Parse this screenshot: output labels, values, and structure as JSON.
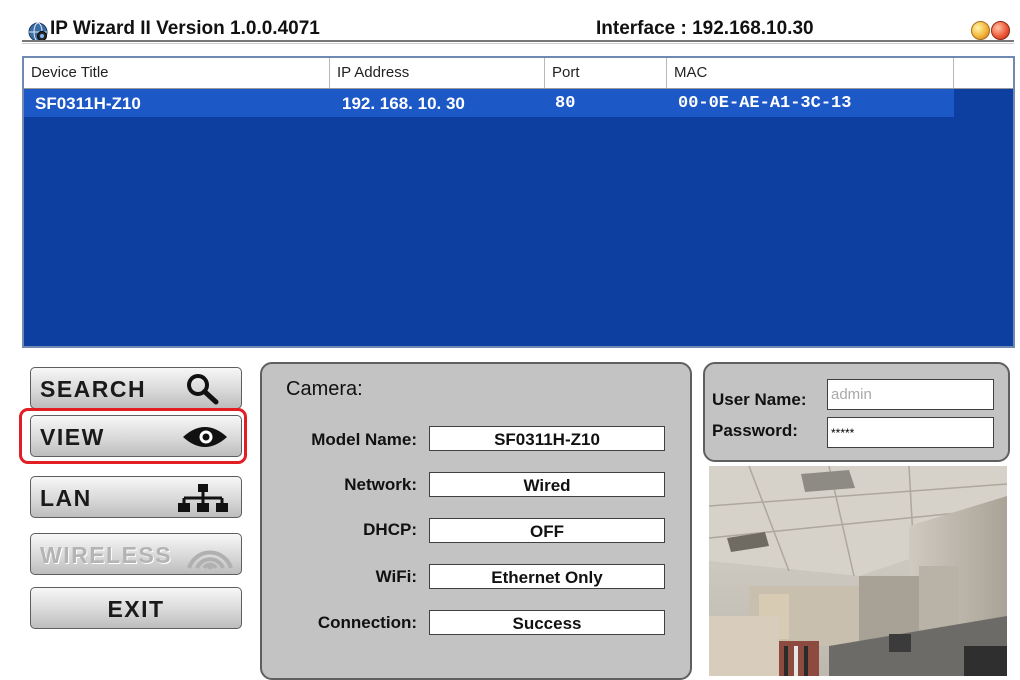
{
  "titlebar": {
    "title": "IP Wizard II  Version 1.0.0.4071",
    "interface": "Interface : 192.168.10.30",
    "logo_icon": "globe-camera-icon",
    "minimize_icon": "minimize-orb-icon",
    "close_icon": "close-orb-icon"
  },
  "device_list": {
    "columns": [
      "Device Title",
      "IP Address",
      "Port",
      "MAC"
    ],
    "rows": [
      {
        "title": "SF0311H-Z10",
        "ip": "192. 168. 10. 30",
        "port": "80",
        "mac": "00-0E-AE-A1-3C-13"
      }
    ],
    "background_color": "#0c3fa0",
    "selected_row_color": "#1d58c7"
  },
  "buttons": {
    "search": {
      "label": "SEARCH",
      "icon": "magnifier-icon"
    },
    "view": {
      "label": "VIEW",
      "icon": "eye-icon",
      "highlighted": true
    },
    "lan": {
      "label": "LAN",
      "icon": "network-icon"
    },
    "wireless": {
      "label": "WIRELESS",
      "icon": "wifi-icon",
      "enabled": false
    },
    "exit": {
      "label": "EXIT"
    }
  },
  "highlight_color": "#e11e24",
  "camera": {
    "heading": "Camera:",
    "fields": [
      {
        "label": "Model Name:",
        "value": "SF0311H-Z10"
      },
      {
        "label": "Network:",
        "value": "Wired"
      },
      {
        "label": "DHCP:",
        "value": "OFF"
      },
      {
        "label": "WiFi:",
        "value": "Ethernet Only"
      },
      {
        "label": "Connection:",
        "value": "Success"
      }
    ]
  },
  "login": {
    "username_label": "User Name:",
    "username_value": "admin",
    "password_label": "Password:",
    "password_value": "*****"
  },
  "preview": {
    "description_icon": "camera-preview-image"
  }
}
